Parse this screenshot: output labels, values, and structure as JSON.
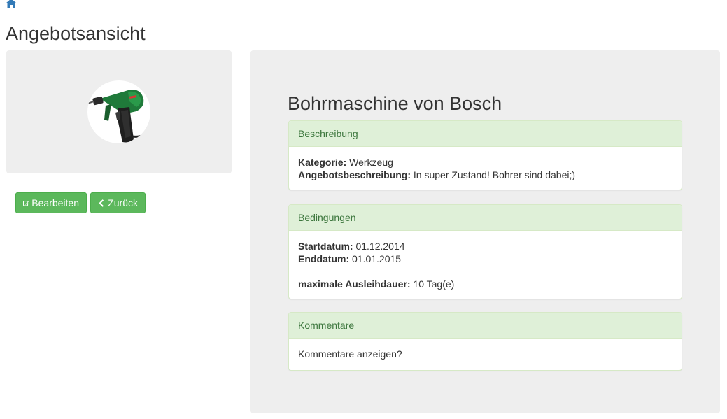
{
  "page": {
    "title": "Angebotsansicht"
  },
  "nav": {
    "home_icon": "home-icon"
  },
  "actions": {
    "edit_label": "Bearbeiten",
    "back_label": "Zurück",
    "edit_icon": "edit-icon",
    "back_icon": "chevron-left-icon",
    "button_color": "#5cb85c"
  },
  "offer": {
    "title": "Bohrmaschine von Bosch",
    "description_panel": {
      "heading": "Beschreibung",
      "category_label": "Kategorie:",
      "category_value": "Werkzeug",
      "desc_label": "Angebotsbeschreibung:",
      "desc_value": "In super Zustand! Bohrer sind dabei;)"
    },
    "conditions_panel": {
      "heading": "Bedingungen",
      "start_label": "Startdatum:",
      "start_value": "01.12.2014",
      "end_label": "Enddatum:",
      "end_value": "01.01.2015",
      "duration_label": "maximale Ausleihdauer:",
      "duration_value": "10 Tag(e)"
    },
    "comments_panel": {
      "heading": "Kommentare",
      "link_text": "Kommentare anzeigen?"
    }
  },
  "colors": {
    "panel_heading_bg": "#dff0d8",
    "panel_heading_text": "#3c763d",
    "well_bg": "#eeeeee"
  }
}
